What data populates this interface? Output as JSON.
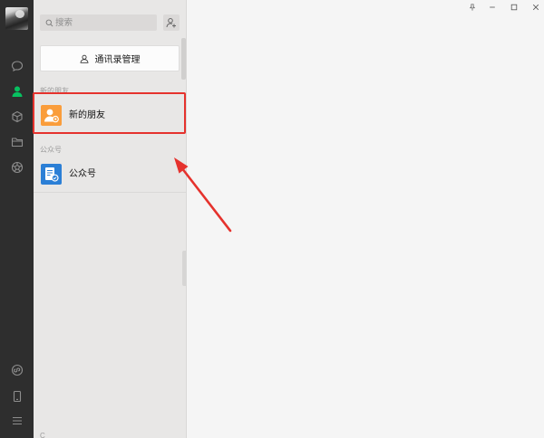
{
  "colors": {
    "sidebar_bg": "#2e2e2e",
    "panel_bg": "#e8e7e6",
    "main_bg": "#f5f5f5",
    "icon_default": "#8e8e8e",
    "icon_active": "#07c160"
  },
  "sidebar": {
    "nav": [
      {
        "icon": "chat-icon",
        "active": false
      },
      {
        "icon": "contacts-icon",
        "active": true
      },
      {
        "icon": "cube-icon",
        "active": false
      },
      {
        "icon": "folder-icon",
        "active": false
      },
      {
        "icon": "moments-icon",
        "active": false
      }
    ],
    "bottom": [
      {
        "icon": "mini-program-icon"
      },
      {
        "icon": "phone-icon"
      },
      {
        "icon": "menu-icon"
      }
    ]
  },
  "window_controls": [
    {
      "icon": "pin-icon"
    },
    {
      "icon": "minimize-icon"
    },
    {
      "icon": "maximize-icon"
    },
    {
      "icon": "close-icon"
    }
  ],
  "contacts": {
    "search": {
      "placeholder": "搜索",
      "icon": "search-icon"
    },
    "add_contact": {
      "icon": "add-contact-icon"
    },
    "manage_button": {
      "label": "通讯录管理",
      "icon": "contacts-manage-icon"
    },
    "sections": [
      {
        "header": "新的朋友",
        "items": [
          {
            "label": "新的朋友",
            "icon": "new-friend-icon",
            "icon_bg": "#fa9d3b",
            "highlighted": true
          }
        ]
      },
      {
        "header": "公众号",
        "items": [
          {
            "label": "公众号",
            "icon": "official-account-icon",
            "icon_bg": "#2b7fd6",
            "highlighted": false
          }
        ]
      },
      {
        "header": "C",
        "items": []
      }
    ]
  },
  "annotation": {
    "color": "#e5322d"
  }
}
